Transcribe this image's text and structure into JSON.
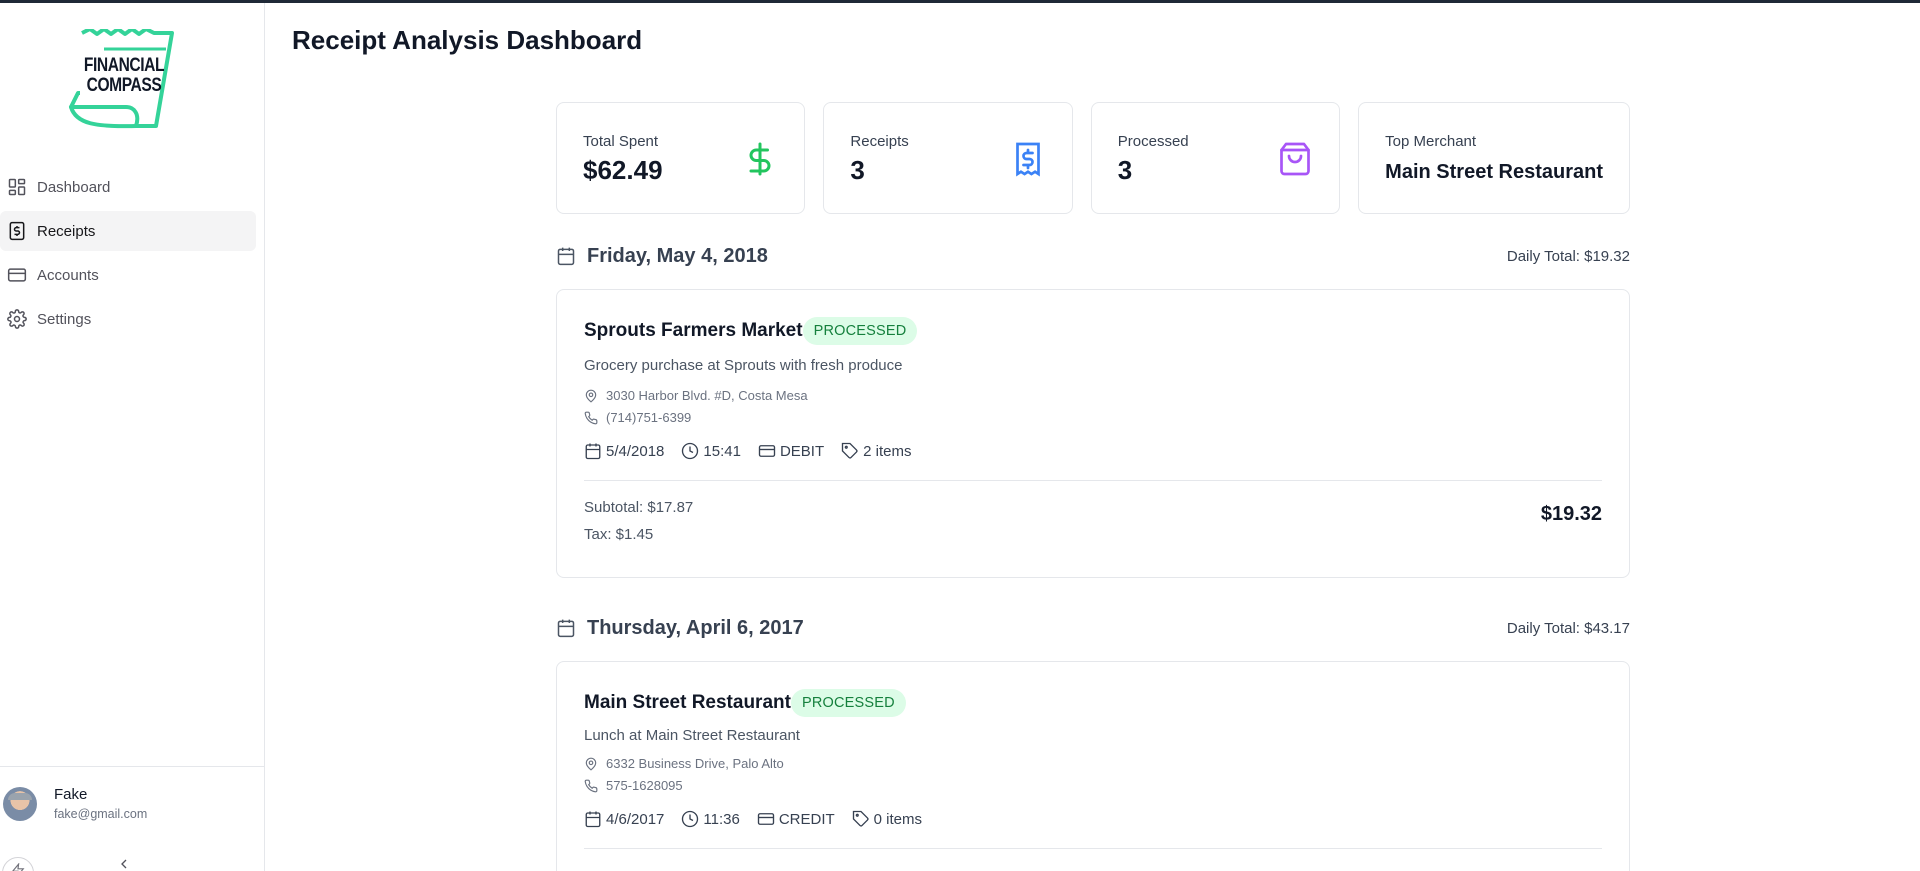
{
  "brand": {
    "logo_line1": "FINANCIAL",
    "logo_line2": "COMPASS",
    "accent": "#34d399"
  },
  "sidebar": {
    "items": [
      {
        "label": "Dashboard",
        "icon": "dashboard-grid-icon",
        "active": false
      },
      {
        "label": "Receipts",
        "icon": "receipt-dollar-icon",
        "active": true
      },
      {
        "label": "Accounts",
        "icon": "credit-card-icon",
        "active": false
      },
      {
        "label": "Settings",
        "icon": "gear-icon",
        "active": false
      }
    ],
    "user": {
      "name": "Fake",
      "email": "fake@gmail.com"
    }
  },
  "main": {
    "title": "Receipt Analysis Dashboard",
    "stats": [
      {
        "label": "Total Spent",
        "value": "$62.49",
        "icon": "dollar-icon",
        "color": "#22c55e"
      },
      {
        "label": "Receipts",
        "value": "3",
        "icon": "receipt-icon",
        "color": "#3b82f6"
      },
      {
        "label": "Processed",
        "value": "3",
        "icon": "shopping-bag-icon",
        "color": "#a855f7"
      },
      {
        "label": "Top Merchant",
        "value": "Main Street Restaurant"
      }
    ],
    "days": [
      {
        "date": "Friday, May 4, 2018",
        "daily_total": "Daily Total: $19.32",
        "receipt": {
          "merchant": "Sprouts Farmers Market",
          "status": "PROCESSED",
          "description": "Grocery purchase at Sprouts with fresh produce",
          "address": "3030 Harbor Blvd. #D, Costa Mesa",
          "phone": "(714)751-6399",
          "date": "5/4/2018",
          "time": "15:41",
          "payment": "DEBIT",
          "items": "2 items",
          "subtotal": "Subtotal: $17.87",
          "tax": "Tax: $1.45",
          "total": "$19.32"
        }
      },
      {
        "date": "Thursday, April 6, 2017",
        "daily_total": "Daily Total: $43.17",
        "receipt": {
          "merchant": "Main Street Restaurant",
          "status": "PROCESSED",
          "description": "Lunch at Main Street Restaurant",
          "address": "6332 Business Drive, Palo Alto",
          "phone": "575-1628095",
          "date": "4/6/2017",
          "time": "11:36",
          "payment": "CREDIT",
          "items": "0 items"
        }
      }
    ]
  }
}
